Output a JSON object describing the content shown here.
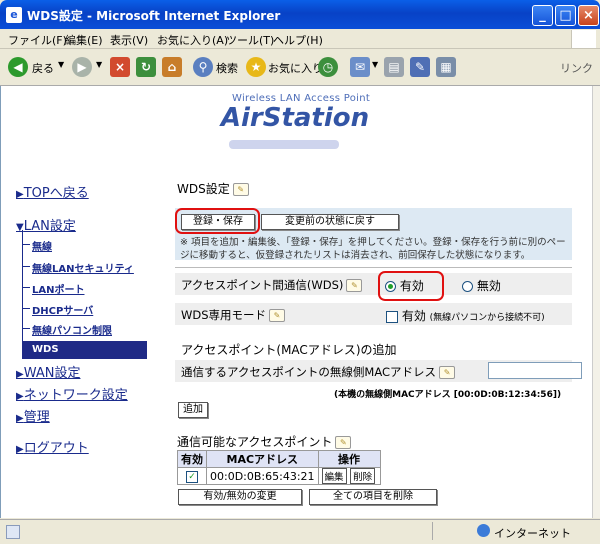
{
  "window": {
    "title": "WDS設定 - Microsoft Internet Explorer"
  },
  "menu": [
    "ファイル(F)",
    "編集(E)",
    "表示(V)",
    "お気に入り(A)",
    "ツール(T)",
    "ヘルプ(H)"
  ],
  "toolbar": {
    "back": "戻る",
    "search": "検索",
    "favorites": "お気に入り",
    "links": "リンク"
  },
  "logo": {
    "subtitle": "Wireless LAN Access Point",
    "brand": "AirStation"
  },
  "nav": {
    "top": "TOPへ戻る",
    "lan": "LAN設定",
    "lan_items": [
      "無線",
      "無線LANセキュリティ",
      "LANポート",
      "DHCPサーバ",
      "無線パソコン制限",
      "WDS"
    ],
    "wan": "WAN設定",
    "network": "ネットワーク設定",
    "admin": "管理",
    "logout": "ログアウト"
  },
  "main": {
    "heading": "WDS設定",
    "save_button": "登録・保存",
    "revert_button": "変更前の状態に戻す",
    "note_line1": "※ 項目を追加・編集後、「登録・保存」を押してください。登録・保存を行う前に別のペー",
    "note_line2": "ジに移動すると、仮登録されたリストは消去され、前回保存した状態になります。",
    "wds_label": "アクセスポイント間通信(WDS)",
    "enable": "有効",
    "disable": "無効",
    "dedicated_label": "WDS専用モード",
    "dedicated_enable": "有効",
    "dedicated_note": "(無線パソコンから接続不可)",
    "add_section_title": "アクセスポイント(MACアドレス)の追加",
    "mac_input_label": "通信するアクセスポイントの無線側MACアドレス",
    "mac_input_value": "",
    "own_mac_note": "(本機の無線側MACアドレス [00:0D:0B:12:34:56])",
    "add_button": "追加",
    "list_title": "通信可能なアクセスポイント",
    "table": {
      "headers": [
        "有効",
        "MACアドレス",
        "操作"
      ],
      "rows": [
        {
          "enabled": true,
          "mac": "00:0D:0B:65:43:21",
          "edit": "編集",
          "delete": "削除"
        }
      ]
    },
    "toggle_button": "有効/無効の変更",
    "delete_all_button": "全ての項目を削除"
  },
  "status": {
    "zone": "インターネット"
  }
}
